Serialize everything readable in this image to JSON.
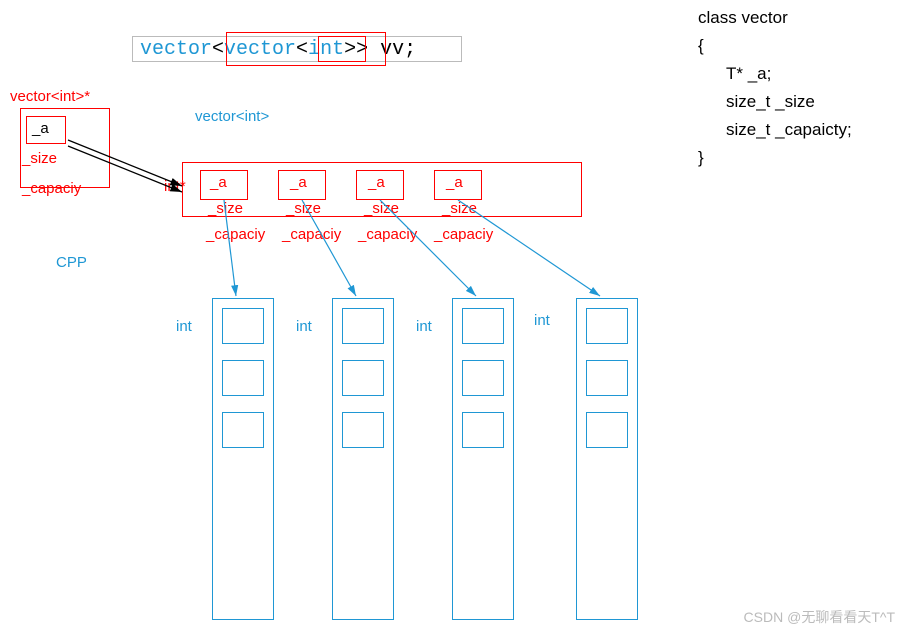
{
  "decl": {
    "t1": "vector",
    "lt1": "<",
    "t2": "vector",
    "lt2": "<",
    "t3": "int",
    "gt": ">>",
    "v": " vv;"
  },
  "ptrLabel": "vector<int>*",
  "innerTypeLabel": "vector<int>",
  "outerStruct": {
    "a": "_a",
    "size": "_size",
    "capacity": "_capaciy"
  },
  "row": {
    "prefix": "int*",
    "cells": [
      {
        "a": "_a",
        "size": "_size",
        "cap": "_capaciy"
      },
      {
        "a": "_a",
        "size": "_size",
        "cap": "_capaciy"
      },
      {
        "a": "_a",
        "size": "_size",
        "cap": "_capaciy"
      },
      {
        "a": "_a",
        "size": "_size",
        "cap": "_capaciy"
      }
    ]
  },
  "cpp": "CPP",
  "colLabel": [
    "int",
    "int",
    "int",
    "int"
  ],
  "cls": {
    "l1": "class vector",
    "l2": "{",
    "l3": "T*  _a;",
    "l4": "size_t _size",
    "l5": "size_t _capaicty;",
    "l6": "}"
  },
  "watermark": "CSDN @无聊看看天T^T",
  "arrow_color": "#000",
  "blue_arrow_color": "#1f97d4"
}
